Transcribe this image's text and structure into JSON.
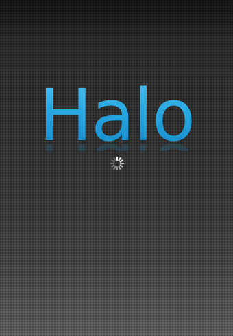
{
  "app": {
    "logo_text": "Halo"
  },
  "spinner": {
    "icon": "activity-spinner-icon"
  },
  "colors": {
    "logo": "#2aa6e0",
    "background_top": "#202020",
    "background_bottom": "#5e5e5e"
  }
}
